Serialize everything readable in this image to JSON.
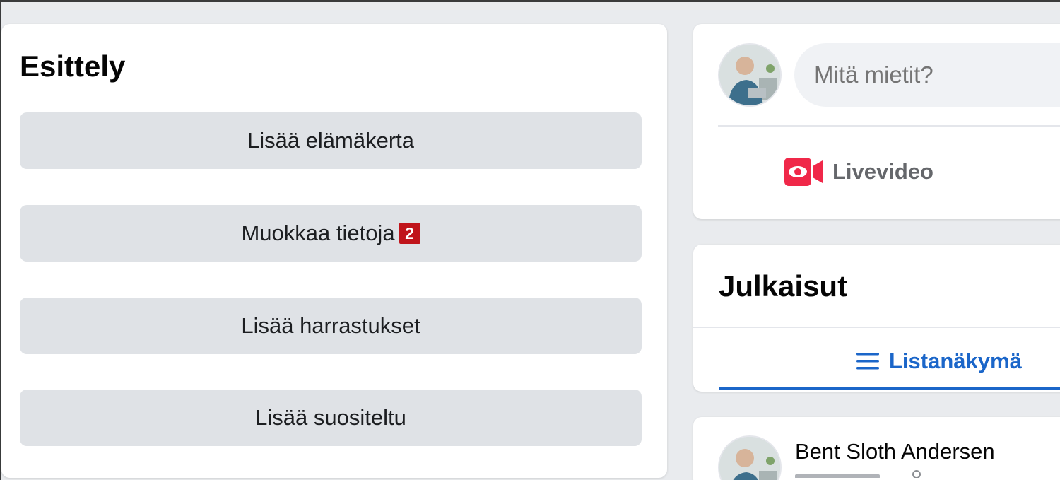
{
  "intro": {
    "title": "Esittely",
    "buttons": [
      {
        "label": "Lisää elämäkerta"
      },
      {
        "label": "Muokkaa tietoja",
        "badge": "2"
      },
      {
        "label": "Lisää harrastukset"
      },
      {
        "label": "Lisää suositeltu"
      }
    ]
  },
  "composer": {
    "placeholder": "Mitä mietit?",
    "live_label": "Livevideo"
  },
  "posts": {
    "title": "Julkaisut",
    "list_view_label": "Listanäkymä"
  },
  "post": {
    "author": "Bent Sloth Andersen"
  },
  "colors": {
    "accent": "#1b66c9",
    "badge": "#c0141b",
    "live_icon": "#f02849",
    "button_bg": "#dfe2e6",
    "page_bg": "#e9ebee"
  }
}
